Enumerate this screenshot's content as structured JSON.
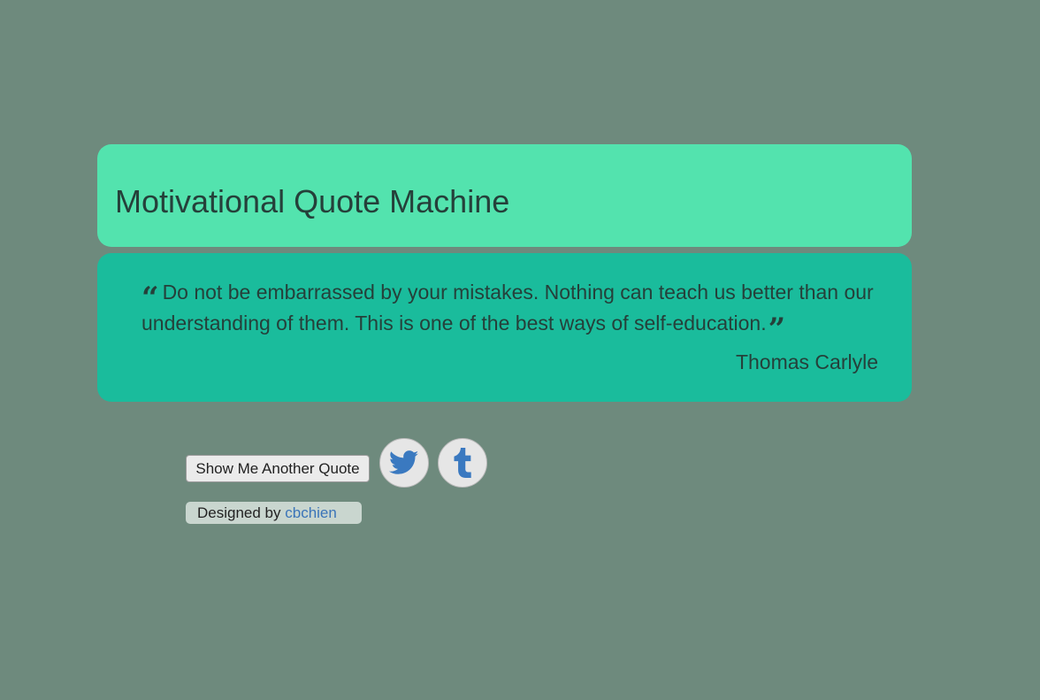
{
  "header": {
    "title": "Motivational Quote Machine"
  },
  "quote": {
    "text": "Do not be embarrassed by your mistakes. Nothing can teach us better than our understanding of them. This is one of the best ways of self-education.",
    "author": "Thomas Carlyle",
    "open_mark_icon": "quote-left-icon",
    "close_mark_icon": "quote-right-icon"
  },
  "actions": {
    "new_quote_label": "Show Me Another Quote",
    "twitter_icon": "twitter-icon",
    "tumblr_icon": "tumblr-icon"
  },
  "footer": {
    "designed_by_label": "Designed by",
    "designer_link": "cbchien"
  },
  "colors": {
    "background": "#6e8a7d",
    "header_card": "#53e3ae",
    "quote_card": "#1abc9c",
    "icon_blue": "#3a79c0",
    "link": "#3a74b8"
  }
}
